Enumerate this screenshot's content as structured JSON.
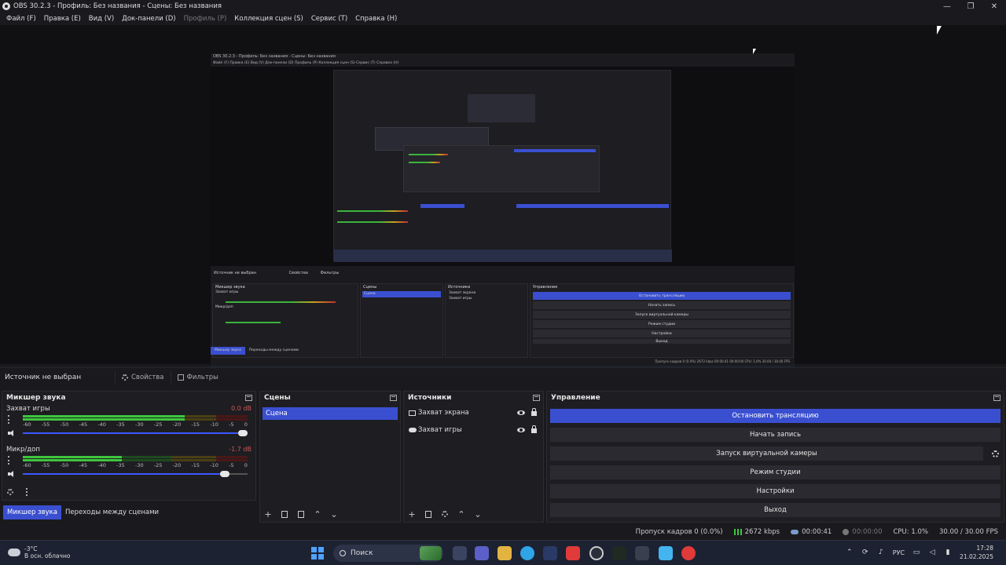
{
  "window": {
    "title": "OBS 30.2.3 - Профиль: Без названия - Сцены: Без названия",
    "minimize": "—",
    "maximize": "❐",
    "close": "✕"
  },
  "menu": [
    {
      "label": "Файл (F)",
      "disabled": false
    },
    {
      "label": "Правка (E)",
      "disabled": false
    },
    {
      "label": "Вид (V)",
      "disabled": false
    },
    {
      "label": "Док-панели (D)",
      "disabled": false
    },
    {
      "label": "Профиль (P)",
      "disabled": true
    },
    {
      "label": "Коллекция сцен (S)",
      "disabled": false
    },
    {
      "label": "Сервис (T)",
      "disabled": false
    },
    {
      "label": "Справка (H)",
      "disabled": false
    }
  ],
  "source_bar": {
    "no_source": "Источник не выбран",
    "properties": "Свойства",
    "filters": "Фильтры"
  },
  "mixer": {
    "title": "Микшер звука",
    "channels": [
      {
        "name": "Захват игры",
        "db": "0.0 dB",
        "level": 0.72,
        "volume": 1.0
      },
      {
        "name": "Микр/доп",
        "db": "-1.7 dB",
        "level": 0.44,
        "volume": 0.92
      }
    ],
    "scale": [
      "-60",
      "-55",
      "-50",
      "-45",
      "-40",
      "-35",
      "-30",
      "-25",
      "-20",
      "-15",
      "-10",
      "-5",
      "0"
    ]
  },
  "scenes": {
    "title": "Сцены",
    "items": [
      "Сцена"
    ]
  },
  "sources": {
    "title": "Источники",
    "items": [
      {
        "name": "Захват экрана",
        "icon": "monitor-icon"
      },
      {
        "name": "Захват игры",
        "icon": "gamepad-icon"
      }
    ]
  },
  "controls": {
    "title": "Управление",
    "stop_stream": "Остановить трансляцию",
    "start_record": "Начать запись",
    "virtual_cam": "Запуск виртуальной камеры",
    "studio_mode": "Режим студии",
    "settings": "Настройки",
    "exit": "Выход"
  },
  "bottom_tabs": {
    "mixer": "Микшер звука",
    "transitions": "Переходы между сценами"
  },
  "status": {
    "dropped": "Пропуск кадров 0 (0.0%)",
    "bitrate": "2672 kbps",
    "stream_time": "00:00:41",
    "rec_time": "00:00:00",
    "cpu": "CPU: 1.0%",
    "fps": "30.00 / 30.00 FPS"
  },
  "mini": {
    "title": "OBS 30.2.3 - Профиль: Без названия - Сцены: Без названия",
    "menu": "Файл (F)   Правка (E)   Вид (V)   Док-панели (D)   Профиль (P)   Коллекция сцен (S)   Сервис (T)   Справка (H)",
    "no_source": "Источник не выбран",
    "properties": "Свойства",
    "filters": "Фильтры",
    "mixer": "Микшер звука",
    "scenes": "Сцены",
    "sources": "Источники",
    "controls": "Управление",
    "scene": "Сцена",
    "src1": "Захват экрана",
    "src2": "Захват игры",
    "ch1": "Захват игры",
    "ch2": "Микр/доп",
    "stop": "Остановить трансляцию",
    "rec": "Начать запись",
    "vcam": "Запуск виртуальной камеры",
    "studio": "Режим студии",
    "settings": "Настройки",
    "exit": "Выход",
    "tab_mixer": "Микшер звука",
    "tab_trans": "Переходы между сценами",
    "status": "Пропуск кадров 0 (0.0%)   2672 kbps   00:00:41   00:00:00   CPU: 1.0%   30.00 / 30.00 FPS",
    "weather": "-3°C",
    "weather_sub": "В осн. облачно",
    "search": "Поиск",
    "time": "17:28",
    "date": "21.02.2025"
  },
  "taskbar": {
    "temp": "-3°C",
    "weather": "В осн. облачно",
    "search": "Поиск",
    "lang": "РУС",
    "time": "17:28",
    "date": "21.02.2025"
  },
  "colors": {
    "accent": "#3a4fd0",
    "bg": "#1e1e22",
    "meter_green": "#3ec53e"
  }
}
